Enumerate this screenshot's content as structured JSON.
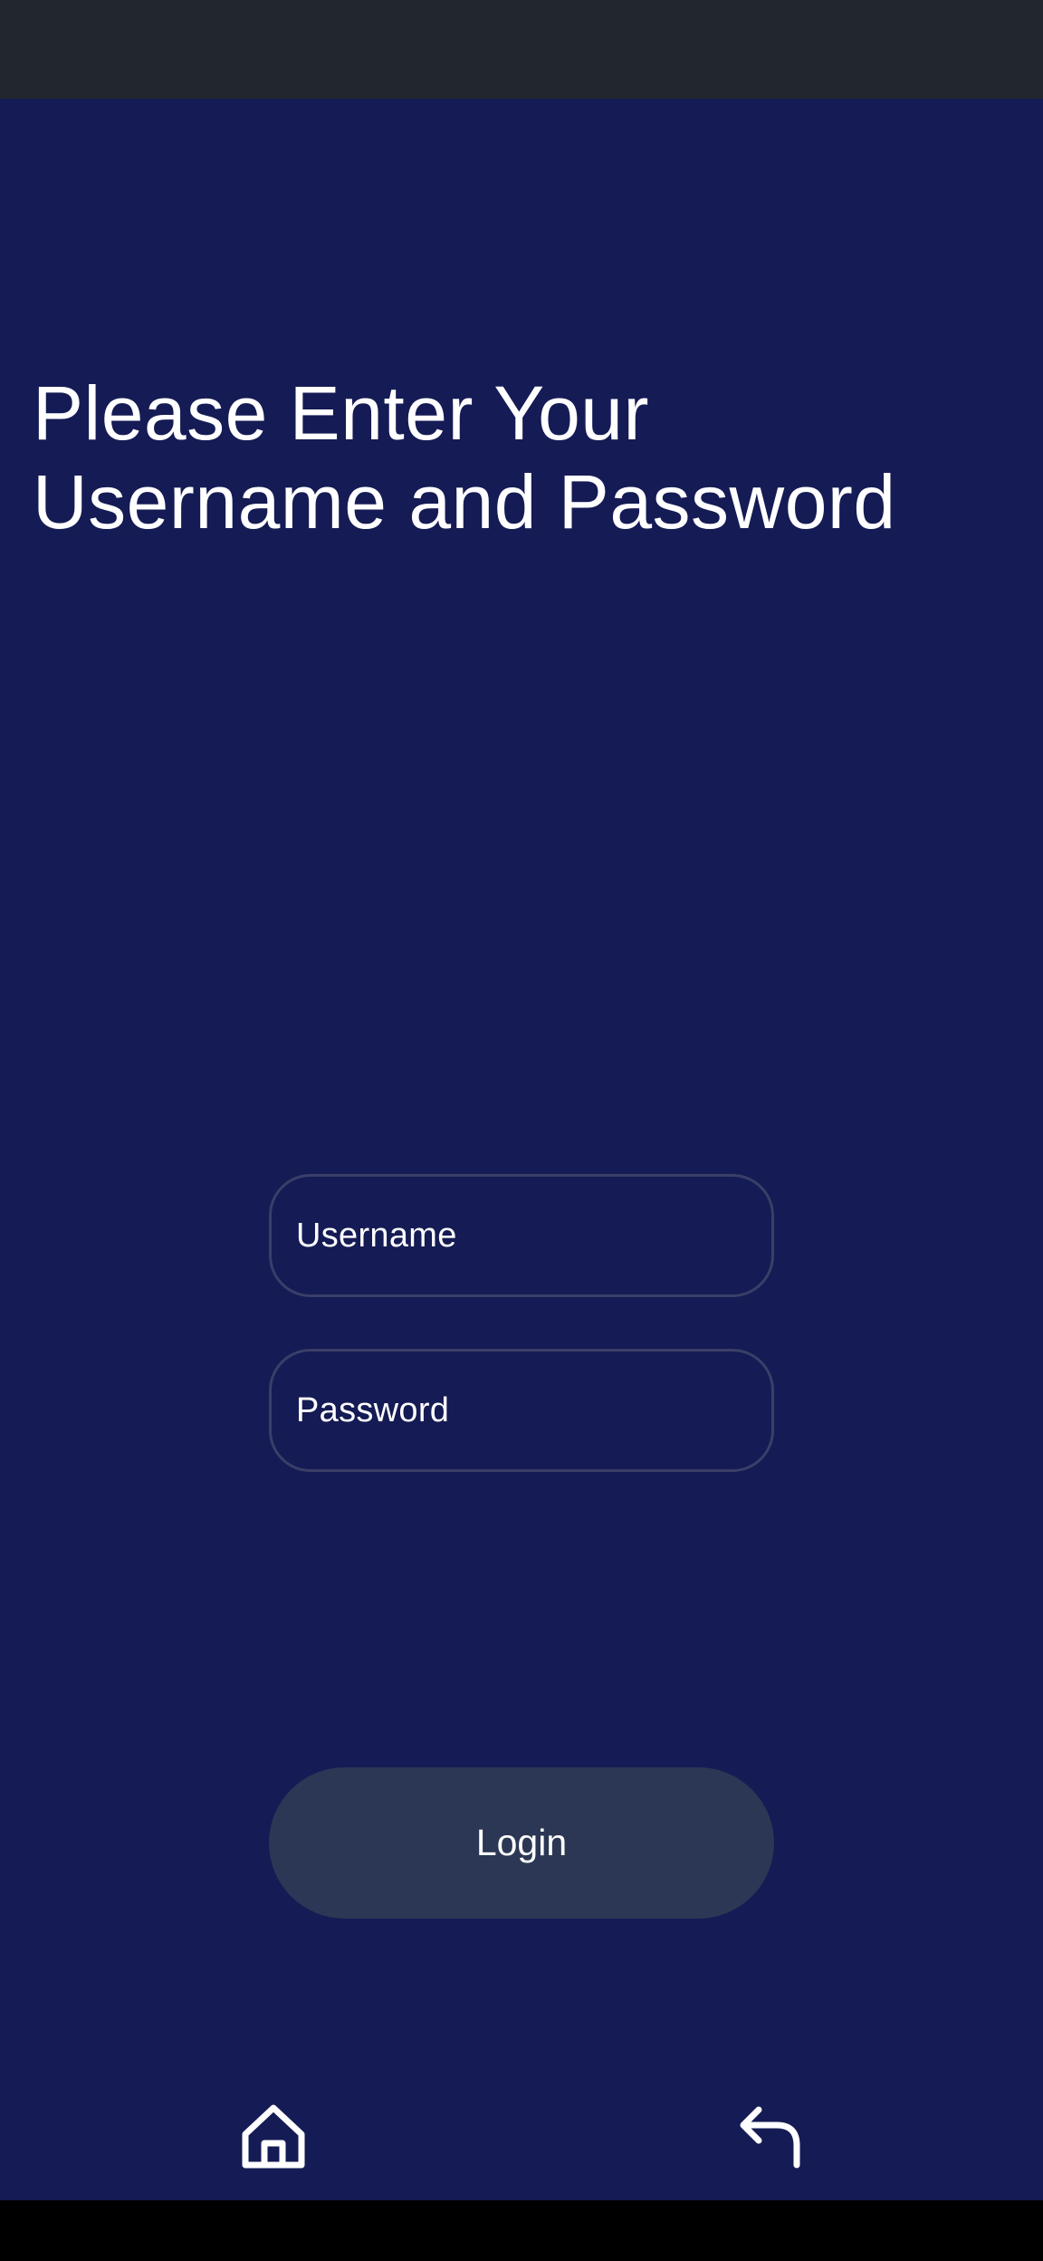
{
  "screen": {
    "title": "Please Enter Your Username and Password"
  },
  "form": {
    "username_placeholder": "Username",
    "password_placeholder": "Password",
    "login_label": "Login"
  },
  "navigation": {
    "home_icon": "home-icon",
    "back_icon": "back-arrow-icon"
  },
  "colors": {
    "background": "#151b54",
    "status_bar": "#22262f",
    "field_border": "#3a3f68",
    "button_background": "#2b3754",
    "text": "#ffffff"
  }
}
